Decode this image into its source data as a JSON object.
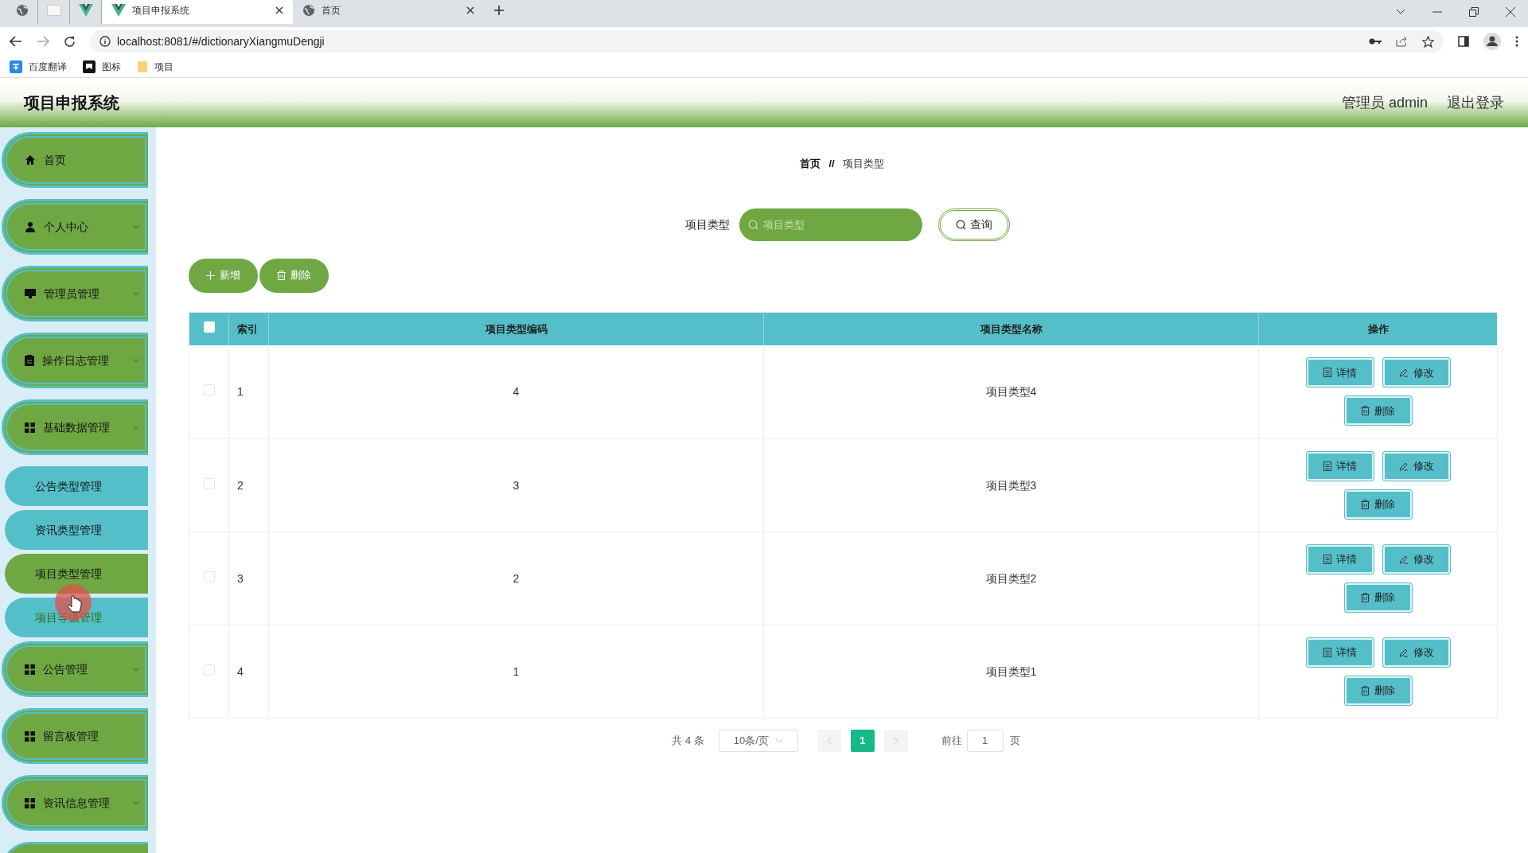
{
  "browser": {
    "tabs": [
      {
        "kind": "globe",
        "selected": false
      },
      {
        "kind": "blank",
        "selected": false
      },
      {
        "kind": "vue",
        "selected": false
      },
      {
        "kind": "vue",
        "label": "项目申报系统",
        "selected": true
      },
      {
        "kind": "globe",
        "label": "首页",
        "selected": false
      }
    ],
    "address": "localhost:8081/#/dictionaryXiangmuDengji",
    "bookmarks": [
      {
        "kind": "translate",
        "label": "百度翻译"
      },
      {
        "kind": "flag",
        "label": "图标"
      },
      {
        "kind": "folder",
        "label": "项目"
      }
    ]
  },
  "header": {
    "title": "项目申报系统",
    "user": "管理员 admin",
    "logout": "退出登录"
  },
  "sidebar": {
    "items": [
      {
        "kind": "menu",
        "label": "首页",
        "expandable": false
      },
      {
        "kind": "menu",
        "label": "个人中心",
        "expandable": true
      },
      {
        "kind": "menu",
        "label": "管理员管理",
        "expandable": true
      },
      {
        "kind": "menu",
        "label": "操作日志管理",
        "expandable": true
      },
      {
        "kind": "menu",
        "label": "基础数据管理",
        "expandable": true
      },
      {
        "kind": "sub",
        "label": "公告类型管理",
        "selected": false
      },
      {
        "kind": "sub",
        "label": "资讯类型管理",
        "selected": false
      },
      {
        "kind": "sub",
        "label": "项目类型管理",
        "selected": true
      },
      {
        "kind": "sub",
        "label": "项目等级管理",
        "selected": false
      },
      {
        "kind": "menu",
        "label": "公告管理",
        "expandable": true
      },
      {
        "kind": "menu",
        "label": "留言板管理",
        "expandable": false
      },
      {
        "kind": "menu",
        "label": "资讯信息管理",
        "expandable": true
      }
    ]
  },
  "breadcrumb": [
    "首页",
    "//",
    "项目类型"
  ],
  "search": {
    "label": "项目类型",
    "placeholder": "项目类型",
    "button": "查询"
  },
  "actions": [
    "新增",
    "删除"
  ],
  "table": {
    "select_all_checked": false,
    "columns": [
      "索引",
      "项目类型编码",
      "项目类型名称",
      "操作"
    ],
    "rows": [
      {
        "index": "1",
        "code": "4",
        "name": "项目类型4",
        "checked": false,
        "buttons": [
          "详情",
          "修改",
          "删除"
        ]
      },
      {
        "index": "2",
        "code": "3",
        "name": "项目类型3",
        "checked": false,
        "buttons": [
          "详情",
          "修改",
          "删除"
        ]
      },
      {
        "index": "3",
        "code": "2",
        "name": "项目类型2",
        "checked": false,
        "buttons": [
          "详情",
          "修改",
          "删除"
        ]
      },
      {
        "index": "4",
        "code": "1",
        "name": "项目类型1",
        "checked": false,
        "buttons": [
          "详情",
          "修改",
          "删除"
        ]
      }
    ]
  },
  "pagination": {
    "total": "共 4 条",
    "page_size": "10条/页",
    "pages": [
      {
        "label": "1",
        "selected": true
      }
    ],
    "goto": "前往",
    "goto_value": "1",
    "goto_suffix": "页"
  }
}
